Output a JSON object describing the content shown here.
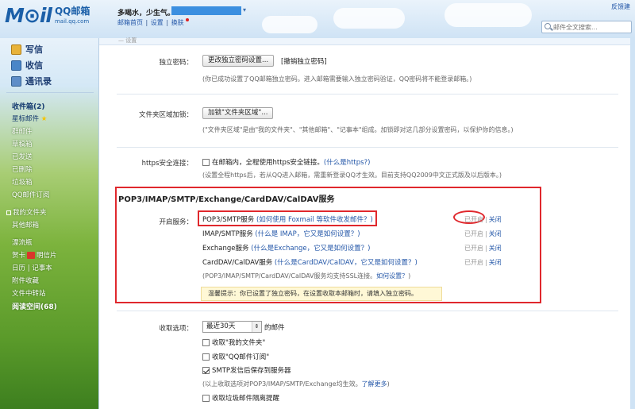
{
  "header": {
    "logo_main": "M⊙il",
    "logo_cn": "QQ邮箱",
    "logo_domain": "mail.qq.com",
    "user_greeting": "多喝水，少生气。",
    "nav_links": [
      "邮箱首页",
      "设置",
      "换肤"
    ],
    "feedback_label": "反馈建",
    "search_placeholder": "邮件全文搜索..."
  },
  "sidebar": {
    "write": "写信",
    "inbox": "收信",
    "contacts": "通讯录",
    "folders": {
      "inbox_count": "收件箱(2)",
      "starred": "星标邮件",
      "groups": "群邮件",
      "drafts": "草稿箱",
      "sent": "已发送",
      "deleted": "已删除",
      "spam": "垃圾箱",
      "subscription": "QQ邮件订阅",
      "my_folders": "我的文件夹",
      "other_mailbox": "其他邮箱",
      "drift_bottle": "漂流瓶",
      "greeting_card": "贺卡",
      "postcard": "明信片",
      "calendar": "日历",
      "notepad": "记事本",
      "attachments": "附件收藏",
      "file_transfer": "文件中转站",
      "reading_space": "阅读空间(68)"
    }
  },
  "settings": {
    "top_fragment": "— 设置",
    "independent_password": {
      "label": "独立密码：",
      "button": "更改独立密码设置...",
      "link": "[撤销独立密码]",
      "note": "(你已成功设置了QQ邮箱独立密码。进入邮箱需要输入独立密码验证，QQ密码将不能登录邮箱。)"
    },
    "folder_encrypt": {
      "label": "文件夹区域加锁：",
      "button": "加锁\"文件夹区域\"...",
      "note": "(\"文件夹区域\"是由\"我的文件夹\"、\"其他邮箱\"、\"记事本\"组成。加锁即对这几部分设置密码，以保护你的信息。)"
    },
    "https": {
      "label": "https安全连接：",
      "checkbox_text": "在邮箱内，全程使用https安全链接。",
      "link": "(什么是https?)",
      "note": "(设置全程https后，若从QQ进入邮箱，需重新登录QQ才生效。目前支持QQ2009中文正式版及以后版本。)"
    },
    "pop3": {
      "title": "POP3/IMAP/SMTP/Exchange/CardDAV/CalDAV服务",
      "open_label": "开启服务：",
      "services": [
        {
          "name": "POP3/SMTP服务",
          "help": "(如何使用 Foxmail 等软件收发邮件？)",
          "status": "已开启",
          "action": "关闭"
        },
        {
          "name": "IMAP/SMTP服务",
          "help": "(什么是 IMAP，它又是如何设置？)",
          "status": "已开启",
          "action": "关闭"
        },
        {
          "name": "Exchange服务",
          "help": "(什么是Exchange，它又是如何设置？)",
          "status": "已开启",
          "action": "关闭"
        },
        {
          "name": "CardDAV/CalDAV服务",
          "help": "(什么是CardDAV/CalDAV，它又是如何设置？)",
          "status": "已开启",
          "action": "关闭"
        }
      ],
      "ssl_note": "(POP3/IMAP/SMTP/CardDAV/CalDAV服务均支持SSL连接。",
      "ssl_link": "如何设置？",
      "ssl_close": ")",
      "tip": "温馨提示：你已设置了独立密码，在设置收取本邮箱时，请填入独立密码。"
    },
    "receive": {
      "label": "收取选项：",
      "select_value": "最近30天",
      "select_suffix": "的邮件",
      "options": [
        {
          "text": "收取\"我的文件夹\"",
          "checked": false
        },
        {
          "text": "收取\"QQ邮件订阅\"",
          "checked": false
        },
        {
          "text": "SMTP发信后保存到服务器",
          "checked": true
        }
      ],
      "note": "(以上收取选项对POP3/IMAP/SMTP/Exchange均生效。",
      "note_link": "了解更多",
      "note_close": ")",
      "spam_option": "收取垃圾邮件隔离提醒"
    }
  }
}
